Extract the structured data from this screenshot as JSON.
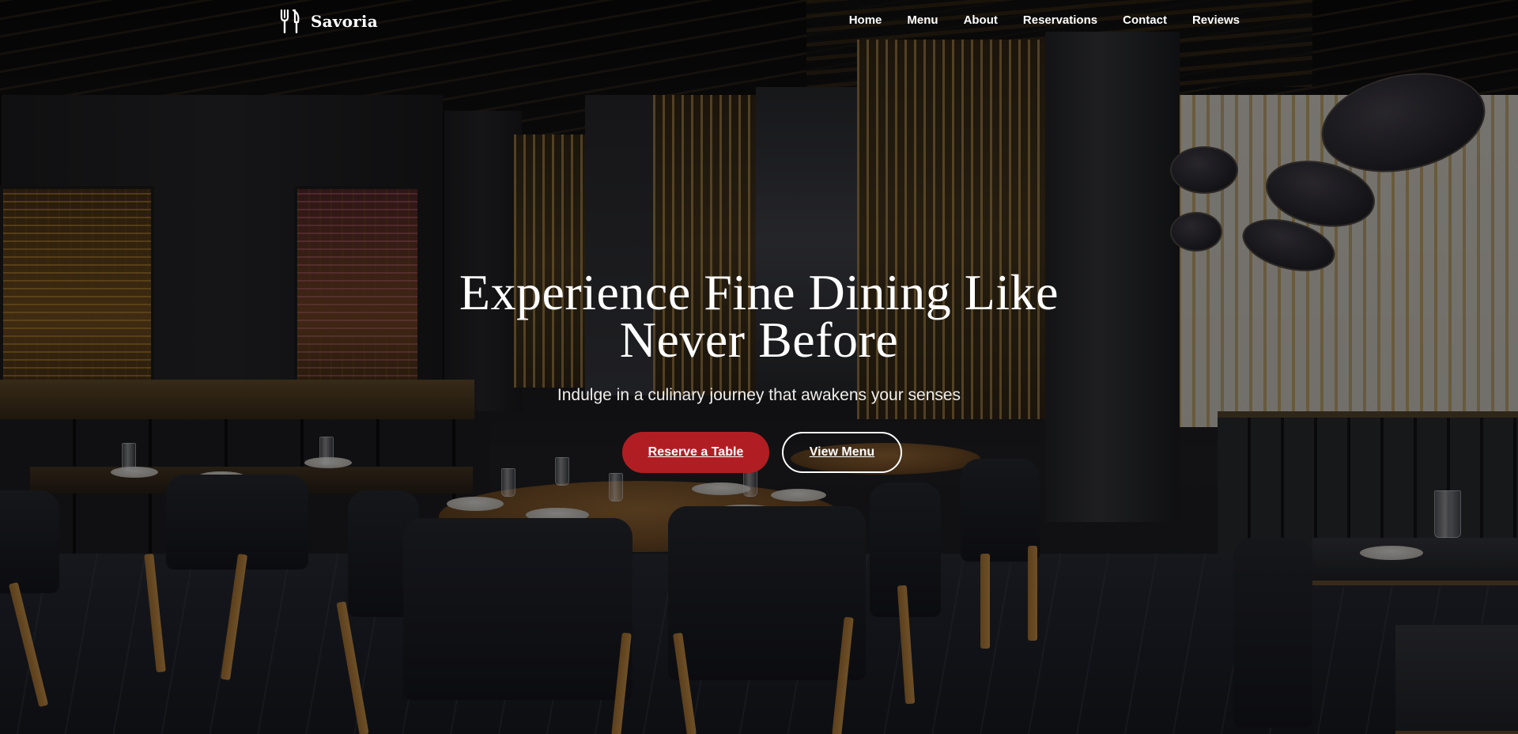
{
  "brand": {
    "name": "Savoria",
    "icon": "fork-knife-icon"
  },
  "nav": {
    "links": [
      "Home",
      "Menu",
      "About",
      "Reservations",
      "Contact",
      "Reviews"
    ]
  },
  "hero": {
    "title": "Experience Fine Dining Like Never Before",
    "subtitle": "Indulge in a culinary journey that awakens your senses",
    "primary_button": "Reserve a Table",
    "secondary_button": "View Menu",
    "background": "restaurant-interior-photo"
  },
  "colors": {
    "accent": "#b01e24",
    "text": "#ffffff",
    "overlay": "rgba(0,0,0,0.48)"
  }
}
